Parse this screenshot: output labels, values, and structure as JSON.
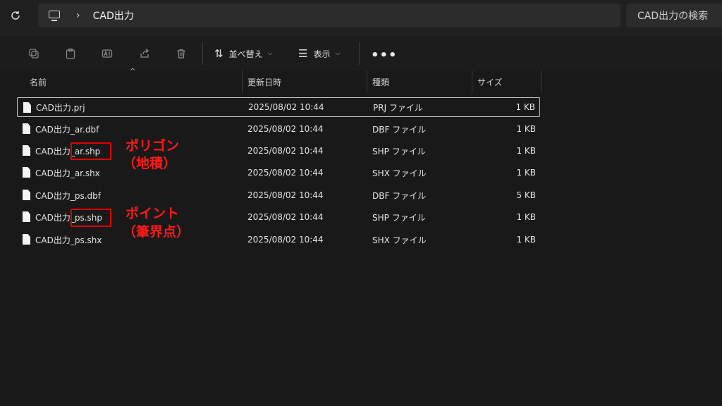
{
  "address_bar": {
    "breadcrumb_separator": "›",
    "current_folder": "CAD出力",
    "search_placeholder": "CAD出力の検索"
  },
  "toolbar": {
    "sort_label": "並べ替え",
    "view_label": "表示",
    "more_label": "•••"
  },
  "columns": {
    "name": "名前",
    "modified": "更新日時",
    "type": "種類",
    "size": "サイズ"
  },
  "files": [
    {
      "name": "CAD出力.prj",
      "modified": "2025/08/02 10:44",
      "type": "PRJ ファイル",
      "size": "1 KB",
      "selected": true
    },
    {
      "name": "CAD出力_ar.dbf",
      "modified": "2025/08/02 10:44",
      "type": "DBF ファイル",
      "size": "1 KB"
    },
    {
      "name": "CAD出力_ar.shp",
      "modified": "2025/08/02 10:44",
      "type": "SHP ファイル",
      "size": "1 KB"
    },
    {
      "name": "CAD出力_ar.shx",
      "modified": "2025/08/02 10:44",
      "type": "SHX ファイル",
      "size": "1 KB"
    },
    {
      "name": "CAD出力_ps.dbf",
      "modified": "2025/08/02 10:44",
      "type": "DBF ファイル",
      "size": "5 KB"
    },
    {
      "name": "CAD出力_ps.shp",
      "modified": "2025/08/02 10:44",
      "type": "SHP ファイル",
      "size": "1 KB"
    },
    {
      "name": "CAD出力_ps.shx",
      "modified": "2025/08/02 10:44",
      "type": "SHX ファイル",
      "size": "1 KB"
    }
  ],
  "annotations": {
    "polygon_line1": "ポリゴン",
    "polygon_line2": "（地積）",
    "point_line1": "ポイント",
    "point_line2": "（筆界点）"
  },
  "colors": {
    "background": "#191919",
    "annotation": "#ff1a1a"
  }
}
